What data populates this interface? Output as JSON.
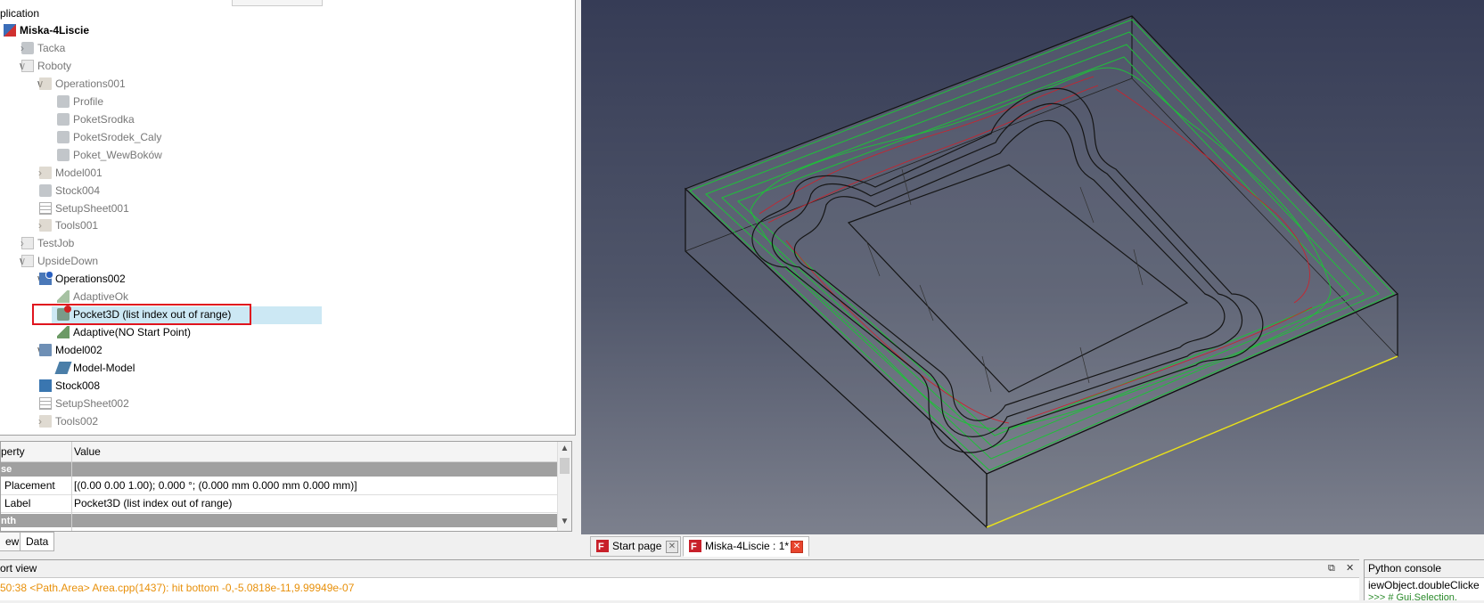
{
  "tree": {
    "root_section": "plication",
    "items": [
      {
        "label": "Miska-4Liscie",
        "chev": "",
        "indent": 0,
        "icon": "document-icon",
        "style": "bold"
      },
      {
        "label": "Tacka",
        "chev": "›",
        "indent": 1,
        "icon": "part-icon",
        "style": "dim"
      },
      {
        "label": "Roboty",
        "chev": "∨",
        "indent": 1,
        "icon": "job-icon",
        "style": "dim"
      },
      {
        "label": "Operations001",
        "chev": "∨",
        "indent": 2,
        "icon": "folder-icon",
        "style": "dim"
      },
      {
        "label": "Profile",
        "chev": "",
        "indent": 3,
        "icon": "profile-icon",
        "style": "dim"
      },
      {
        "label": "PoketSrodka",
        "chev": "",
        "indent": 3,
        "icon": "pocket-icon",
        "style": "dim"
      },
      {
        "label": "PoketSrodek_Caly",
        "chev": "",
        "indent": 3,
        "icon": "pocket-icon",
        "style": "dim"
      },
      {
        "label": "Poket_WewBoków",
        "chev": "",
        "indent": 3,
        "icon": "pocket-icon",
        "style": "dim"
      },
      {
        "label": "Model001",
        "chev": "›",
        "indent": 2,
        "icon": "folder-icon",
        "style": "dim"
      },
      {
        "label": "Stock004",
        "chev": "",
        "indent": 2,
        "icon": "stock-icon",
        "style": "dim"
      },
      {
        "label": "SetupSheet001",
        "chev": "",
        "indent": 2,
        "icon": "setupsheet-icon",
        "style": "dim"
      },
      {
        "label": "Tools001",
        "chev": "›",
        "indent": 2,
        "icon": "folder-icon",
        "style": "dim"
      },
      {
        "label": "TestJob",
        "chev": "›",
        "indent": 1,
        "icon": "job-icon",
        "style": "dim"
      },
      {
        "label": "UpsideDown",
        "chev": "∨",
        "indent": 1,
        "icon": "job-icon",
        "style": "dim"
      },
      {
        "label": "Operations002",
        "chev": "∨",
        "indent": 2,
        "icon": "operations-active-icon",
        "style": "normal"
      },
      {
        "label": "AdaptiveOk",
        "chev": "",
        "indent": 3,
        "icon": "adaptive-icon",
        "style": "dim"
      },
      {
        "label": "Pocket3D (list index out of range)",
        "chev": "",
        "indent": 3,
        "icon": "pocket3d-error-icon",
        "style": "selected"
      },
      {
        "label": "Adaptive(NO Start Point)",
        "chev": "",
        "indent": 3,
        "icon": "adaptive-icon",
        "style": "normal"
      },
      {
        "label": "Model002",
        "chev": "∨",
        "indent": 2,
        "icon": "folder-blue-icon",
        "style": "normal"
      },
      {
        "label": "Model-Model",
        "chev": "",
        "indent": 3,
        "icon": "model-icon",
        "style": "normal"
      },
      {
        "label": "Stock008",
        "chev": "",
        "indent": 2,
        "icon": "stock-blue-icon",
        "style": "normal"
      },
      {
        "label": "SetupSheet002",
        "chev": "",
        "indent": 2,
        "icon": "setupsheet-icon",
        "style": "dim"
      },
      {
        "label": "Tools002",
        "chev": "›",
        "indent": 2,
        "icon": "folder-icon",
        "style": "dim"
      }
    ]
  },
  "properties": {
    "col_property": "perty",
    "col_value": "Value",
    "group": "se",
    "rows": [
      {
        "name": "Placement",
        "value": "[(0.00 0.00 1.00); 0.000 °; (0.000 mm  0.000 mm  0.000 mm)]"
      },
      {
        "name": "Label",
        "value": "Pocket3D (list index out of range)"
      }
    ],
    "partial_group": "nth",
    "tabs": [
      "ew",
      "Data"
    ]
  },
  "doc_tabs": [
    {
      "label": "Start page",
      "active": false
    },
    {
      "label": "Miska-4Liscie : 1*",
      "active": true
    }
  ],
  "report": {
    "title": "ort view",
    "message": "50:38  <Path.Area> Area.cpp(1437): hit bottom -0,-5.0818e-11,9.99949e-07",
    "message2": "                                     "
  },
  "python_console": {
    "title": "Python console",
    "line1": "iewObject.doubleClicke",
    "line2": ">>> # Gui.Selection."
  },
  "colors": {
    "selection": "#cce8f4",
    "highlight_box": "#e0141e",
    "report_warning": "#e8900a",
    "toolpath_green": "#1fbf3a",
    "toolpath_red": "#d0202a",
    "bbox_yellow": "#e8e020"
  }
}
